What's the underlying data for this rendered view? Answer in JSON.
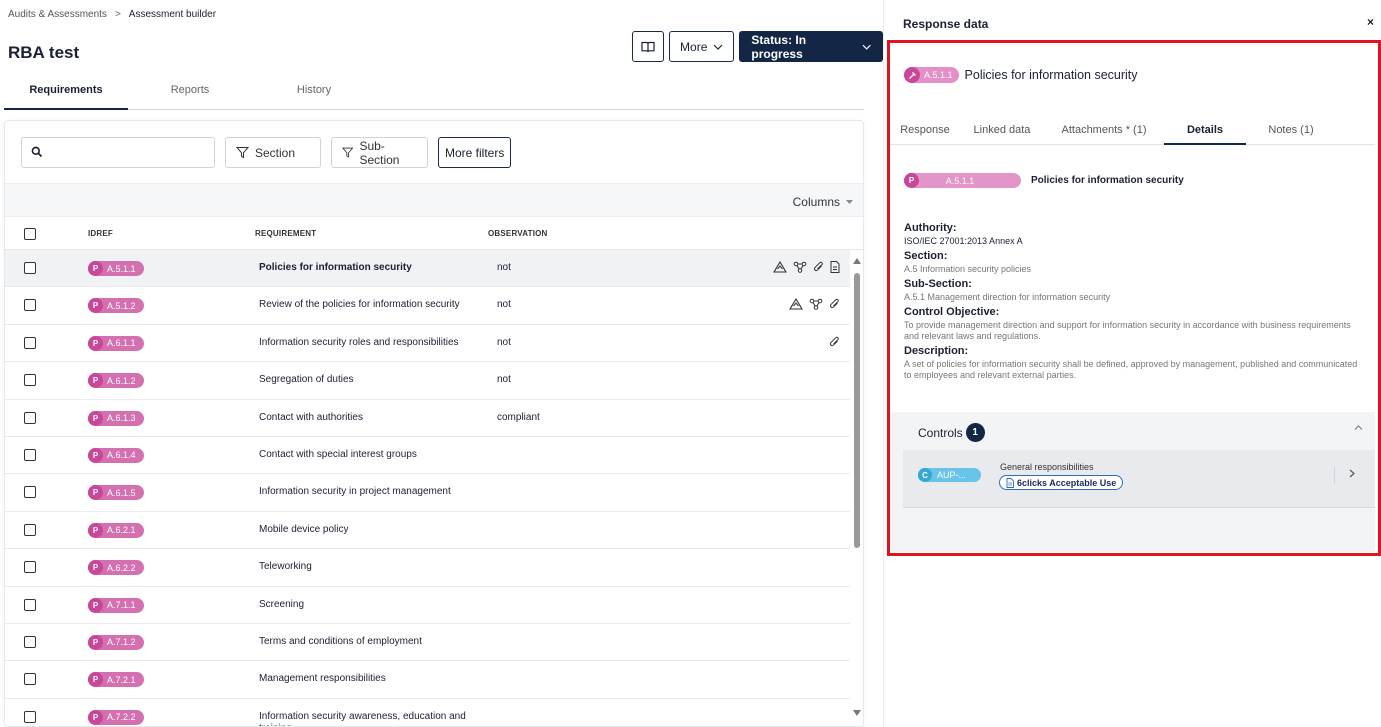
{
  "breadcrumb": {
    "parent": "Audits & Assessments",
    "separator": ">",
    "current": "Assessment builder"
  },
  "page": {
    "title": "RBA test"
  },
  "actions": {
    "more_label": "More",
    "status_label": "Status: In progress"
  },
  "tabs": [
    {
      "label": "Requirements",
      "active": true
    },
    {
      "label": "Reports",
      "active": false
    },
    {
      "label": "History",
      "active": false
    }
  ],
  "filters": {
    "section_label": "Section",
    "subsection_label": "Sub-Section",
    "more_filters_label": "More filters"
  },
  "columns_label": "Columns",
  "table": {
    "headers": {
      "idref": "IDREF",
      "requirement": "REQUIREMENT",
      "observation": "OBSERVATION"
    },
    "rows": [
      {
        "tag": "P",
        "idref": "A.5.1.1",
        "requirement": "Policies for information security",
        "observation": "not",
        "icons": [
          "risk",
          "network",
          "attachment",
          "document"
        ],
        "selected": true
      },
      {
        "tag": "P",
        "idref": "A.5.1.2",
        "requirement": "Review of the policies for information security",
        "observation": "not",
        "icons": [
          "risk",
          "network",
          "attachment"
        ],
        "selected": false
      },
      {
        "tag": "P",
        "idref": "A.6.1.1",
        "requirement": "Information security roles and responsibilities",
        "observation": "not",
        "icons": [
          "attachment"
        ],
        "selected": false
      },
      {
        "tag": "P",
        "idref": "A.6.1.2",
        "requirement": "Segregation of duties",
        "observation": "not",
        "icons": [],
        "selected": false
      },
      {
        "tag": "P",
        "idref": "A.6.1.3",
        "requirement": "Contact with authorities",
        "observation": "compliant",
        "icons": [],
        "selected": false
      },
      {
        "tag": "P",
        "idref": "A.6.1.4",
        "requirement": "Contact with special interest groups",
        "observation": "",
        "icons": [],
        "selected": false
      },
      {
        "tag": "P",
        "idref": "A.6.1.5",
        "requirement": "Information security in project management",
        "observation": "",
        "icons": [],
        "selected": false
      },
      {
        "tag": "P",
        "idref": "A.6.2.1",
        "requirement": "Mobile device policy",
        "observation": "",
        "icons": [],
        "selected": false
      },
      {
        "tag": "P",
        "idref": "A.6.2.2",
        "requirement": "Teleworking",
        "observation": "",
        "icons": [],
        "selected": false
      },
      {
        "tag": "P",
        "idref": "A.7.1.1",
        "requirement": "Screening",
        "observation": "",
        "icons": [],
        "selected": false
      },
      {
        "tag": "P",
        "idref": "A.7.1.2",
        "requirement": "Terms and conditions of employment",
        "observation": "",
        "icons": [],
        "selected": false
      },
      {
        "tag": "P",
        "idref": "A.7.2.1",
        "requirement": "Management responsibilities",
        "observation": "",
        "icons": [],
        "selected": false
      },
      {
        "tag": "P",
        "idref": "A.7.2.2",
        "requirement": "Information security awareness, education and training",
        "observation": "",
        "icons": [],
        "selected": false
      }
    ]
  },
  "panel": {
    "title": "Response data",
    "close": "×",
    "idref": "A.5.1.1",
    "name": "Policies for information security",
    "tabs": [
      {
        "label": "Response",
        "active": false
      },
      {
        "label": "Linked data",
        "active": false
      },
      {
        "label": "Attachments * (1)",
        "active": false
      },
      {
        "label": "Details",
        "active": true
      },
      {
        "label": "Notes (1)",
        "active": false
      }
    ],
    "detail_tag": "P",
    "authority_label": "Authority:",
    "authority": "ISO/IEC 27001:2013 Annex A",
    "section_label": "Section:",
    "section": "A.5 Information security policies",
    "subsection_label": "Sub-Section:",
    "subsection": "A.5.1 Management direction for information security",
    "objective_label": "Control Objective:",
    "objective": "To provide management direction and support for information security in accordance with business requirements and relevant laws and regulations.",
    "description_label": "Description:",
    "description": "A set of policies for information security shall be defined, approved by management, published and communicated to employees and relevant external parties.",
    "controls": {
      "label": "Controls",
      "count": "1",
      "item": {
        "tag": "C",
        "ref": "AUP-...",
        "title": "General responsibilities",
        "policy": "6clicks Acceptable Use"
      }
    }
  },
  "colors": {
    "navy": "#142646",
    "pink": "#d46fb0",
    "pink_dark": "#c8479a",
    "blue": "#69c4ea",
    "highlight": "#e0141e"
  }
}
